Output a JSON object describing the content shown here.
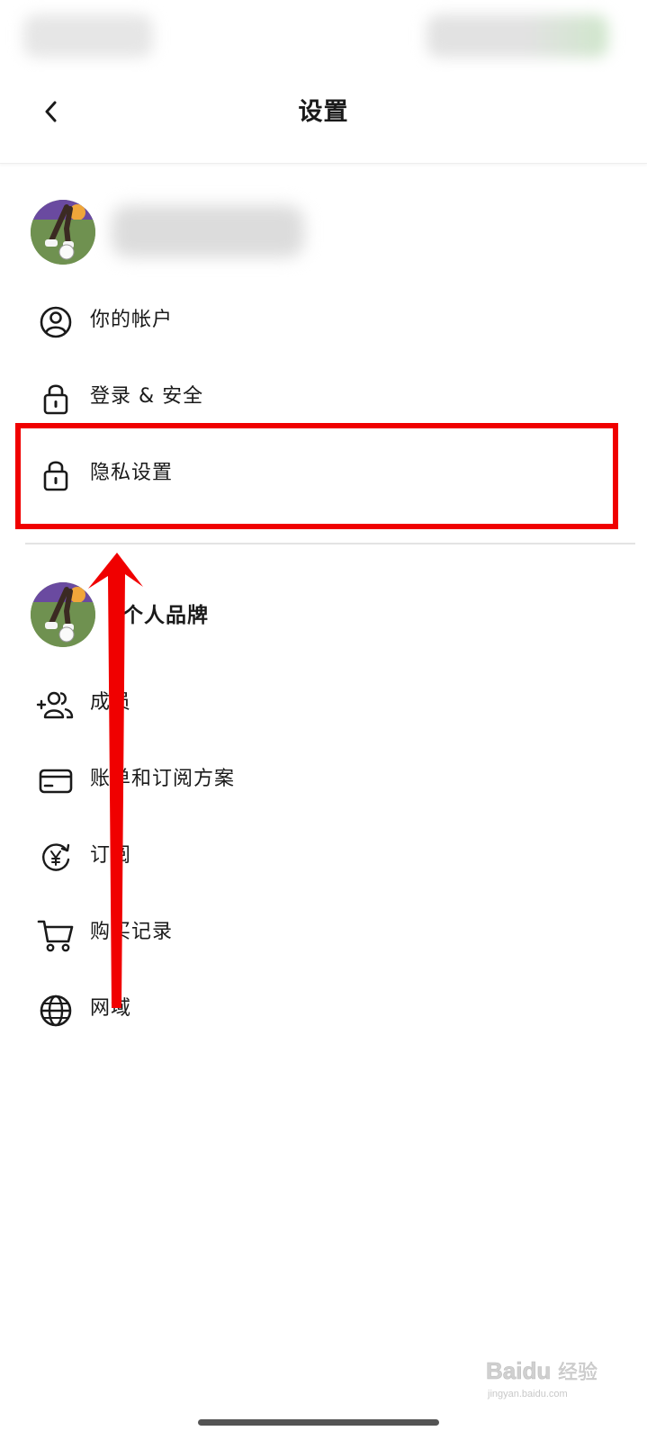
{
  "header": {
    "title": "设置"
  },
  "account_menu": [
    {
      "label": "你的帐户",
      "icon": "user-circle-icon"
    },
    {
      "label": "登录 & 安全",
      "icon": "lock-icon"
    },
    {
      "label": "隐私设置",
      "icon": "lock-icon"
    }
  ],
  "brand_section": {
    "title": "个人品牌"
  },
  "brand_menu": [
    {
      "label": "成员",
      "icon": "add-member-icon"
    },
    {
      "label": "账单和订阅方案",
      "icon": "credit-card-icon"
    },
    {
      "label": "订阅",
      "icon": "yen-subscription-icon"
    },
    {
      "label": "购买记录",
      "icon": "shopping-cart-icon"
    },
    {
      "label": "网域",
      "icon": "globe-icon"
    }
  ],
  "annotation": {
    "highlight_color": "#f00000",
    "highlighted_item": "隐私设置"
  },
  "watermark": {
    "brand": "Baidu",
    "subtitle": "经验",
    "domain": "jingyan.baidu.com"
  }
}
